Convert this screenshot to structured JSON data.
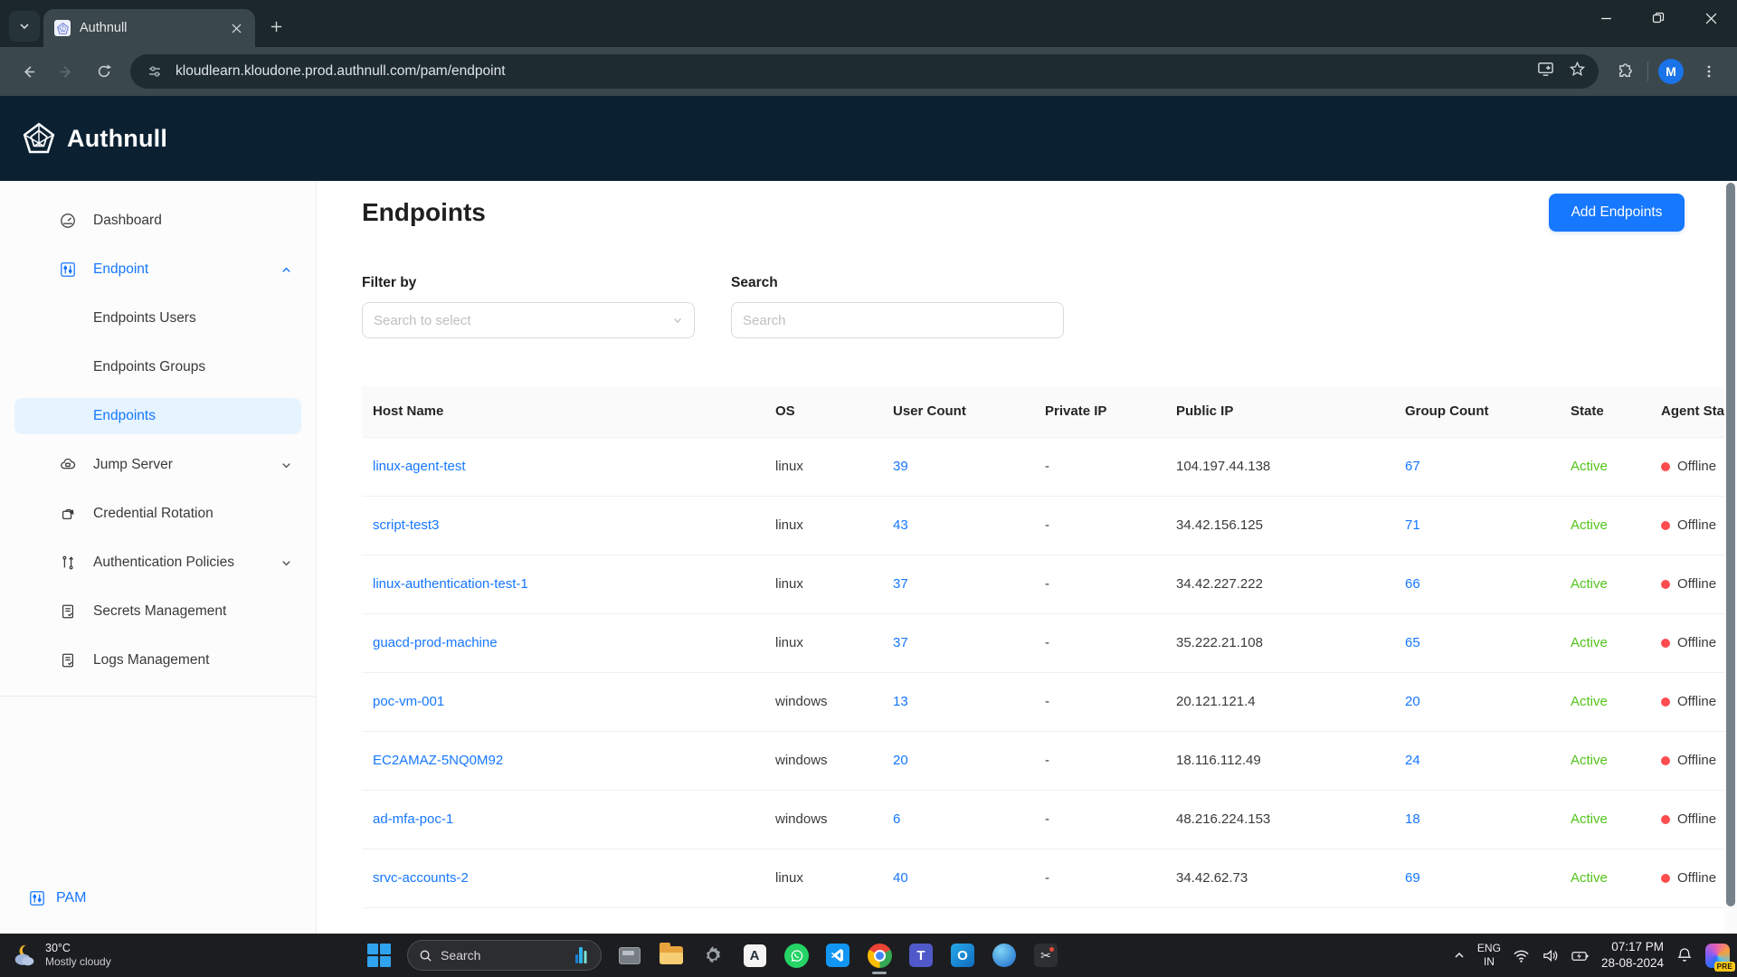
{
  "browser": {
    "tab_title": "Authnull",
    "url": "kloudlearn.kloudone.prod.authnull.com/pam/endpoint",
    "profile_initial": "M"
  },
  "app_header": {
    "brand": "Authnull"
  },
  "sidebar": {
    "items": [
      {
        "label": "Dashboard"
      },
      {
        "label": "Endpoint"
      },
      {
        "label": "Endpoints Users"
      },
      {
        "label": "Endpoints Groups"
      },
      {
        "label": "Endpoints"
      },
      {
        "label": "Jump Server"
      },
      {
        "label": "Credential Rotation"
      },
      {
        "label": "Authentication Policies"
      },
      {
        "label": "Secrets Management"
      },
      {
        "label": "Logs Management"
      }
    ],
    "footer_label": "PAM"
  },
  "page": {
    "title": "Endpoints",
    "add_button": "Add Endpoints",
    "filter_label": "Filter by",
    "filter_placeholder": "Search to select",
    "search_label": "Search",
    "search_placeholder": "Search"
  },
  "table": {
    "columns": [
      "Host Name",
      "OS",
      "User Count",
      "Private IP",
      "Public IP",
      "Group Count",
      "State",
      "Agent Status"
    ],
    "rows": [
      [
        "linux-agent-test",
        "linux",
        "39",
        "-",
        "104.197.44.138",
        "67",
        "Active",
        "Offline"
      ],
      [
        "script-test3",
        "linux",
        "43",
        "-",
        "34.42.156.125",
        "71",
        "Active",
        "Offline"
      ],
      [
        "linux-authentication-test-1",
        "linux",
        "37",
        "-",
        "34.42.227.222",
        "66",
        "Active",
        "Offline"
      ],
      [
        "guacd-prod-machine",
        "linux",
        "37",
        "-",
        "35.222.21.108",
        "65",
        "Active",
        "Offline"
      ],
      [
        "poc-vm-001",
        "windows",
        "13",
        "-",
        "20.121.121.4",
        "20",
        "Active",
        "Offline"
      ],
      [
        "EC2AMAZ-5NQ0M92",
        "windows",
        "20",
        "-",
        "18.116.112.49",
        "24",
        "Active",
        "Offline"
      ],
      [
        "ad-mfa-poc-1",
        "windows",
        "6",
        "-",
        "48.216.224.153",
        "18",
        "Active",
        "Offline"
      ],
      [
        "srvc-accounts-2",
        "linux",
        "40",
        "-",
        "34.42.62.73",
        "69",
        "Active",
        "Offline"
      ]
    ]
  },
  "taskbar": {
    "weather": {
      "temperature": "30°C",
      "condition": "Mostly cloudy"
    },
    "search_placeholder": "Search",
    "icons": [
      "start",
      "search",
      "window-app",
      "file-explorer",
      "settings",
      "app-a",
      "whatsapp",
      "vscode",
      "chrome",
      "teams",
      "outlook",
      "app-blue",
      "snipping-tool"
    ],
    "tray": {
      "language_top": "ENG",
      "language_bottom": "IN",
      "time": "07:17 PM",
      "date": "28-08-2024",
      "copilot_badge": "PRE",
      "app_a_letter": "A",
      "teams_letter": "T",
      "outlook_letter": "O"
    }
  },
  "colors": {
    "accent_blue": "#1677ff",
    "state_active_green": "#52c41a",
    "agent_offline_red": "#ff4d4f",
    "header_navy": "#0b2132"
  }
}
